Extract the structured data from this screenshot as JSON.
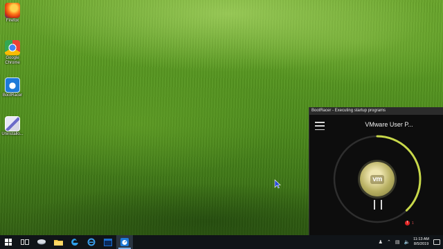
{
  "desktop": {
    "icons": [
      {
        "label": "Firefox",
        "icon": "firefox-icon"
      },
      {
        "label": "Google\nChrome",
        "icon": "chrome-icon"
      },
      {
        "label": "BootRacer",
        "icon": "bootracer-icon"
      },
      {
        "label": "Uninstallo...",
        "icon": "uninstaller-icon"
      }
    ]
  },
  "bootracer": {
    "title": "BootRacer - Executing startup programs",
    "current_program": "VMware User P...",
    "logo_text": "vm",
    "progress": 0.38,
    "alert_count": "1",
    "accent_color": "#c8d84a"
  },
  "taskbar": {
    "items": [
      {
        "name": "start-button",
        "icon": "windows-logo-icon"
      },
      {
        "name": "task-view-button",
        "icon": "task-view-icon"
      },
      {
        "name": "taskbar-app-1",
        "icon": "disk-icon"
      },
      {
        "name": "taskbar-file-explorer",
        "icon": "folder-icon"
      },
      {
        "name": "taskbar-edge",
        "icon": "edge-icon"
      },
      {
        "name": "taskbar-ie",
        "icon": "internet-explorer-icon"
      },
      {
        "name": "taskbar-app-5",
        "icon": "window-app-icon"
      },
      {
        "name": "taskbar-bootracer",
        "icon": "bootracer-icon",
        "active": true
      }
    ],
    "tray": {
      "time": "11:13 AM",
      "date": "8/5/2019"
    }
  }
}
